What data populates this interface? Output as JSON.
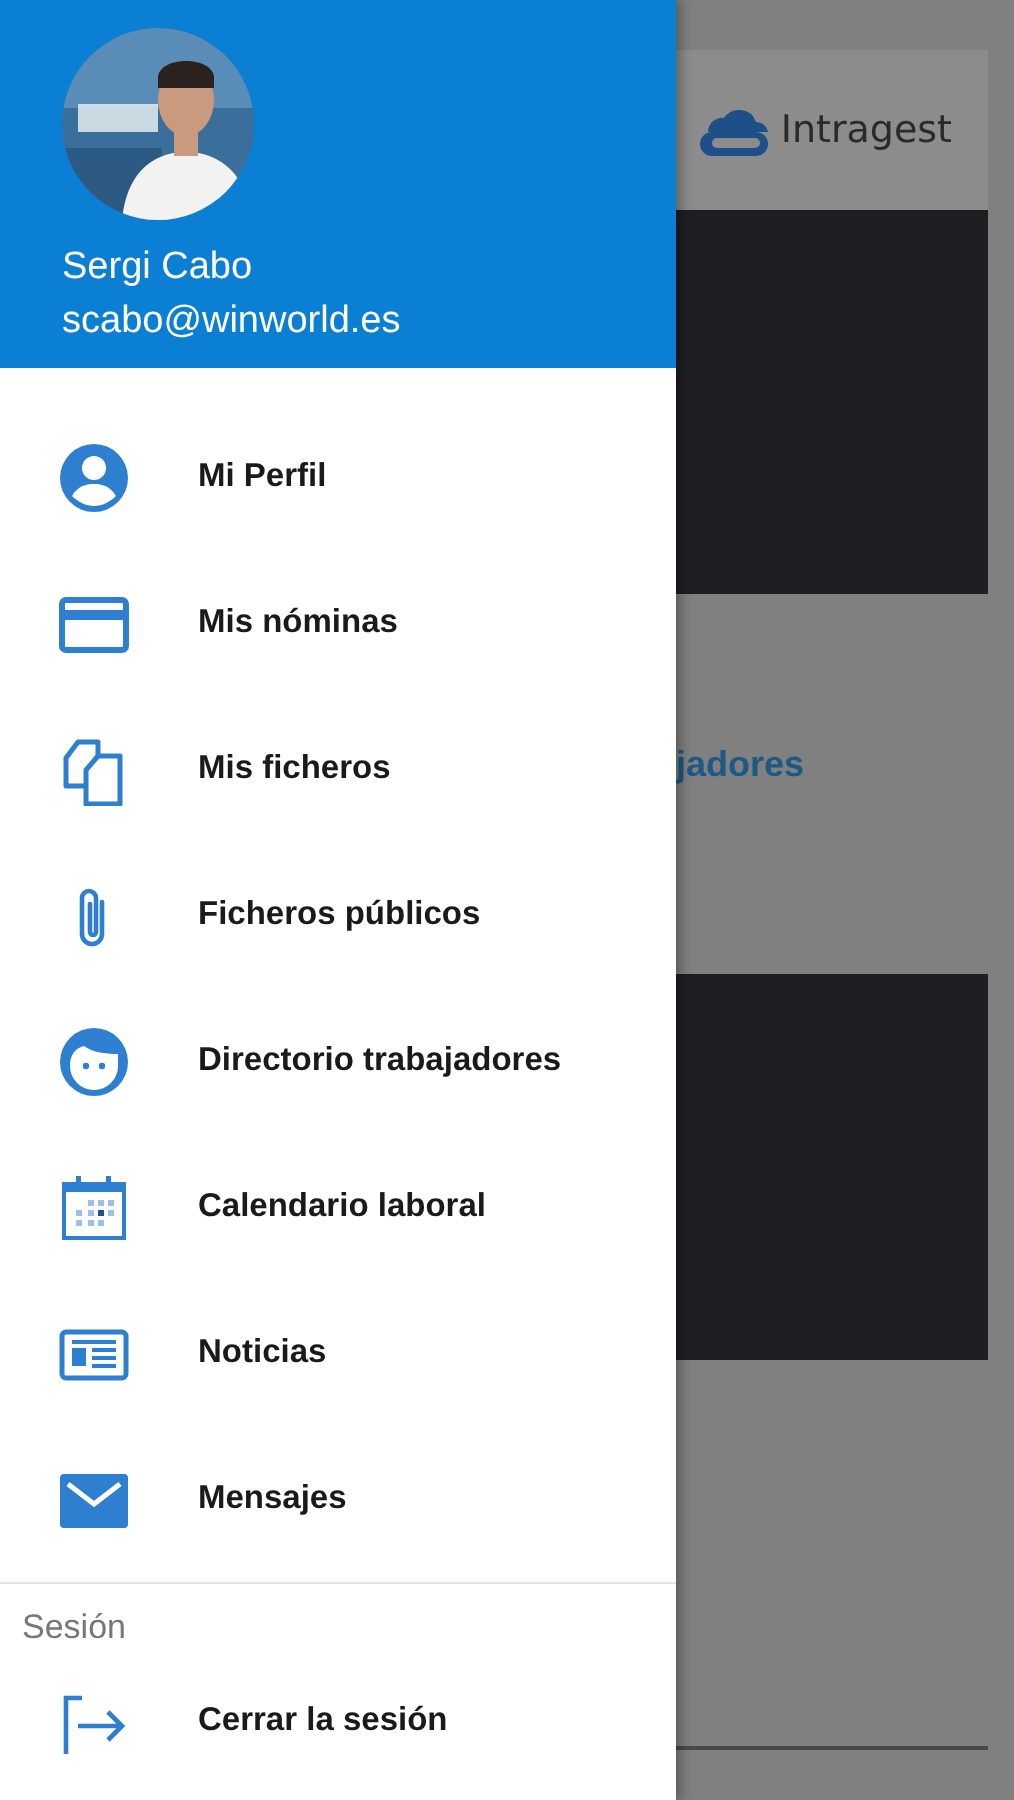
{
  "drawer": {
    "user": {
      "name": "Sergi Cabo",
      "email": "scabo@winworld.es"
    },
    "items": [
      {
        "label": "Mi Perfil"
      },
      {
        "label": "Mis nóminas"
      },
      {
        "label": "Mis ficheros"
      },
      {
        "label": "Ficheros públicos"
      },
      {
        "label": "Directorio trabajadores"
      },
      {
        "label": "Calendario laboral"
      },
      {
        "label": "Noticias"
      },
      {
        "label": "Mensajes"
      }
    ],
    "section_title": "Sesión",
    "session_items": [
      {
        "label": "Cerrar la sesión"
      }
    ]
  },
  "background_screen": {
    "logo_text": "Intragest",
    "partial_text": "jadores"
  }
}
